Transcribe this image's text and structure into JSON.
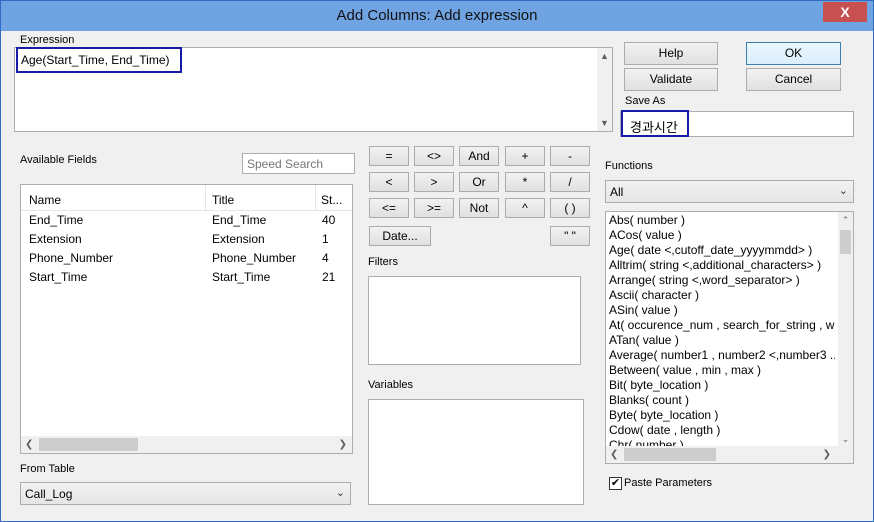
{
  "window": {
    "title": "Add Columns: Add expression",
    "close_glyph": "X"
  },
  "expression": {
    "label": "Expression",
    "value": "Age(Start_Time, End_Time)"
  },
  "buttons": {
    "help": "Help",
    "ok": "OK",
    "validate": "Validate",
    "cancel": "Cancel"
  },
  "save_as": {
    "label": "Save As",
    "value": "경과시간"
  },
  "available_fields": {
    "label": "Available Fields",
    "speed_search_placeholder": "Speed Search",
    "columns": [
      "Name",
      "Title",
      "St..."
    ],
    "rows": [
      [
        "End_Time",
        "End_Time",
        "40"
      ],
      [
        "Extension",
        "Extension",
        "1"
      ],
      [
        "Phone_Number",
        "Phone_Number",
        "4"
      ],
      [
        "Start_Time",
        "Start_Time",
        "21"
      ]
    ]
  },
  "operators": [
    "=",
    "<>",
    "And",
    "+",
    "-",
    "<",
    ">",
    "Or",
    "*",
    "/",
    "<=",
    ">=",
    "Not",
    "^",
    "( )"
  ],
  "date_button": "Date...",
  "quote_button": "\" \"",
  "filters": {
    "label": "Filters"
  },
  "variables": {
    "label": "Variables"
  },
  "from_table": {
    "label": "From Table",
    "value": "Call_Log"
  },
  "functions": {
    "label": "Functions",
    "category": "All",
    "items": [
      "Abs( number )",
      "ACos( value )",
      "Age( date <,cutoff_date_yyyymmdd> )",
      "Alltrim( string <,additional_characters> )",
      "Arrange( string <,word_separator> )",
      "Ascii( character )",
      "ASin( value )",
      "At( occurence_num , search_for_string , wit",
      "ATan( value )",
      "Average( number1 , number2 <,number3 ..",
      "Between( value , min , max )",
      "Bit( byte_location )",
      "Blanks( count )",
      "Byte( byte_location )",
      "Cdow( date , length )",
      "Chr( number )"
    ]
  },
  "paste_parameters": {
    "label": "Paste Parameters",
    "checked": true
  }
}
